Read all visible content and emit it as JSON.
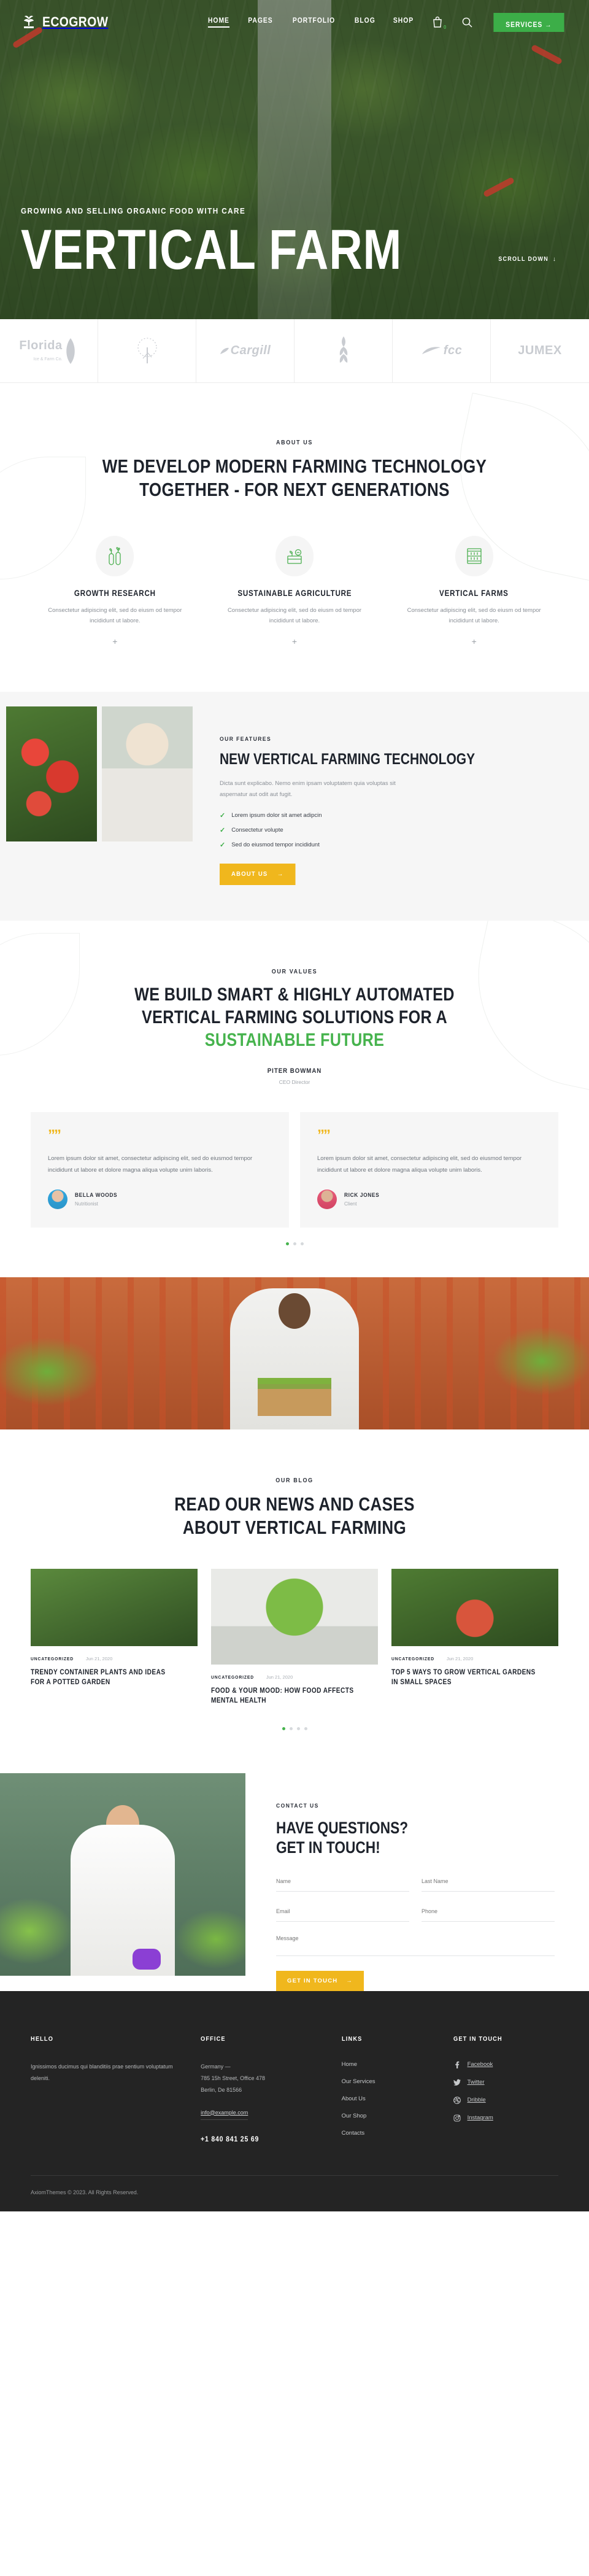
{
  "header": {
    "logo_text": "ECOGROW",
    "logo_icon": "leaf-sprout-icon",
    "nav": [
      {
        "label": "HOME",
        "active": true
      },
      {
        "label": "PAGES",
        "active": false
      },
      {
        "label": "PORTFOLIO",
        "active": false
      },
      {
        "label": "BLOG",
        "active": false
      },
      {
        "label": "SHOP",
        "active": false
      }
    ],
    "cart_icon": "shopping-bag-icon",
    "cart_count": "0",
    "search_icon": "search-icon",
    "cta_label": "SERVICES",
    "cta_arrow": "→",
    "cta_color": "#3cae48"
  },
  "hero": {
    "subtitle": "GROWING AND SELLING ORGANIC FOOD WITH CARE",
    "title": "VERTICAL FARM",
    "scroll_label": "SCROLL DOWN",
    "scroll_arrow": "↓"
  },
  "brands": [
    {
      "name": "Florida",
      "sub": "Ice & Farm Co.",
      "icon": "leaf-logo-icon"
    },
    {
      "name": "",
      "sub": "",
      "icon": "tree-logo-icon"
    },
    {
      "name": "Cargill",
      "sub": "",
      "icon": "cargill-logo-icon"
    },
    {
      "name": "",
      "sub": "",
      "icon": "wheat-logo-icon"
    },
    {
      "name": "fcc",
      "sub": "",
      "icon": "fcc-logo-icon"
    },
    {
      "name": "JUMEX",
      "sub": "",
      "icon": "jumex-logo-icon"
    }
  ],
  "about": {
    "eyebrow": "ABOUT US",
    "heading_line1": "WE DEVELOP MODERN FARMING TECHNOLOGY",
    "heading_line2": "TOGETHER - FOR NEXT GENERATIONS",
    "features": [
      {
        "icon": "test-tube-sprout-icon",
        "title": "GROWTH RESEARCH",
        "text": "Consectetur adipiscing elit, sed do eiusm od tempor incididunt ut labore.",
        "plus": "+"
      },
      {
        "icon": "soil-plant-wifi-icon",
        "title": "SUSTAINABLE AGRICULTURE",
        "text": "Consectetur adipiscing elit, sed do eiusm od tempor incididunt ut labore.",
        "plus": "+"
      },
      {
        "icon": "vertical-rack-icon",
        "title": "VERTICAL FARMS",
        "text": "Consectetur adipiscing elit, sed do eiusm od tempor incididunt ut labore.",
        "plus": "+"
      }
    ]
  },
  "ourfeatures": {
    "eyebrow": "OUR FEATURES",
    "heading": "NEW VERTICAL FARMING TECHNOLOGY",
    "paragraph": "Dicta sunt explicabo. Nemo enim ipsam voluptatem quia voluptas sit aspernatur aut odit aut fugit.",
    "list": [
      "Lorem ipsum dolor sit amet adipcin",
      "Consectetur volupte",
      "Sed do eiusmod tempor incididunt"
    ],
    "button": "ABOUT US",
    "button_arrow": "→",
    "button_color": "#f0b71d",
    "image_left": "tomatoes-photo",
    "image_right": "farmer-woman-photo"
  },
  "values": {
    "eyebrow": "OUR VALUES",
    "line1": "WE BUILD SMART & HIGHLY AUTOMATED",
    "line2": "VERTICAL FARMING SOLUTIONS FOR A",
    "line3": "SUSTAINABLE FUTURE",
    "accent_color": "#46b34d",
    "author": "PITER BOWMAN",
    "author_role": "CEO Director",
    "testimonials": [
      {
        "quote_icon": "quote-icon",
        "text": "Lorem ipsum dolor sit amet, consectetur adipiscing elit, sed do eiusmod tempor incididunt ut labore et dolore magna aliqua volupte unim laboris.",
        "name": "BELLA WOODS",
        "role": "Nutritionist",
        "avatar": "avatar-bella"
      },
      {
        "quote_icon": "quote-icon",
        "text": "Lorem ipsum dolor sit amet, consectetur adipiscing elit, sed do eiusmod tempor incididunt ut labore et dolore magna aliqua volupte unim laboris.",
        "name": "RICK JONES",
        "role": "Client",
        "avatar": "avatar-rick"
      }
    ],
    "dots": 3,
    "active_dot": 0
  },
  "banner": {
    "image": "farm-worker-with-crate-photo"
  },
  "blog": {
    "eyebrow": "OUR BLOG",
    "heading_line1": "READ OUR NEWS AND CASES",
    "heading_line2": "ABOUT VERTICAL FARMING",
    "posts": [
      {
        "image": "greenhouse-couple-photo",
        "category": "UNCATEGORIZED",
        "date": "Jun 21, 2020",
        "title": "TRENDY CONTAINER PLANTS AND IDEAS FOR A POTTED GARDEN"
      },
      {
        "image": "seedling-in-hands-photo",
        "category": "UNCATEGORIZED",
        "date": "Jun 21, 2020",
        "title": "FOOD & YOUR MOOD: HOW FOOD AFFECTS MENTAL HEALTH"
      },
      {
        "image": "farmer-with-tomatoes-photo",
        "category": "UNCATEGORIZED",
        "date": "Jun 21, 2020",
        "title": "TOP 5 WAYS TO GROW VERTICAL GARDENS IN SMALL SPACES"
      }
    ],
    "dots": 4,
    "active_dot": 0
  },
  "contact": {
    "image": "scientist-woman-tablet-photo",
    "eyebrow": "CONTACT US",
    "heading_line1": "HAVE QUESTIONS?",
    "heading_line2": "GET IN TOUCH!",
    "fields": {
      "name_placeholder": "Name",
      "lastname_placeholder": "Last Name",
      "email_placeholder": "Email",
      "phone_placeholder": "Phone",
      "message_placeholder": "Message"
    },
    "button": "GET IN TOUCH",
    "button_arrow": "→",
    "button_color": "#f0b71d"
  },
  "footer": {
    "hello": {
      "title": "HELLO",
      "text": "Ignissimos ducimus qui blanditiis prae sentium voluptatum deleniti."
    },
    "office": {
      "title": "OFFICE",
      "line1": "Germany —",
      "line2": "785 15h Street, Office 478",
      "line3": "Berlin, De 81566",
      "email": "info@example.com",
      "phone": "+1 840 841 25 69"
    },
    "links": {
      "title": "LINKS",
      "items": [
        "Home",
        "Our Services",
        "About Us",
        "Our Shop",
        "Contacts"
      ]
    },
    "social": {
      "title": "GET IN TOUCH",
      "items": [
        {
          "label": "Facebook",
          "icon": "facebook-icon"
        },
        {
          "label": "Twitter",
          "icon": "twitter-icon"
        },
        {
          "label": "Dribble",
          "icon": "dribbble-icon"
        },
        {
          "label": "Instagram",
          "icon": "instagram-icon"
        }
      ]
    },
    "copyright": "AxiomThemes © 2023. All Rights Reserved."
  }
}
